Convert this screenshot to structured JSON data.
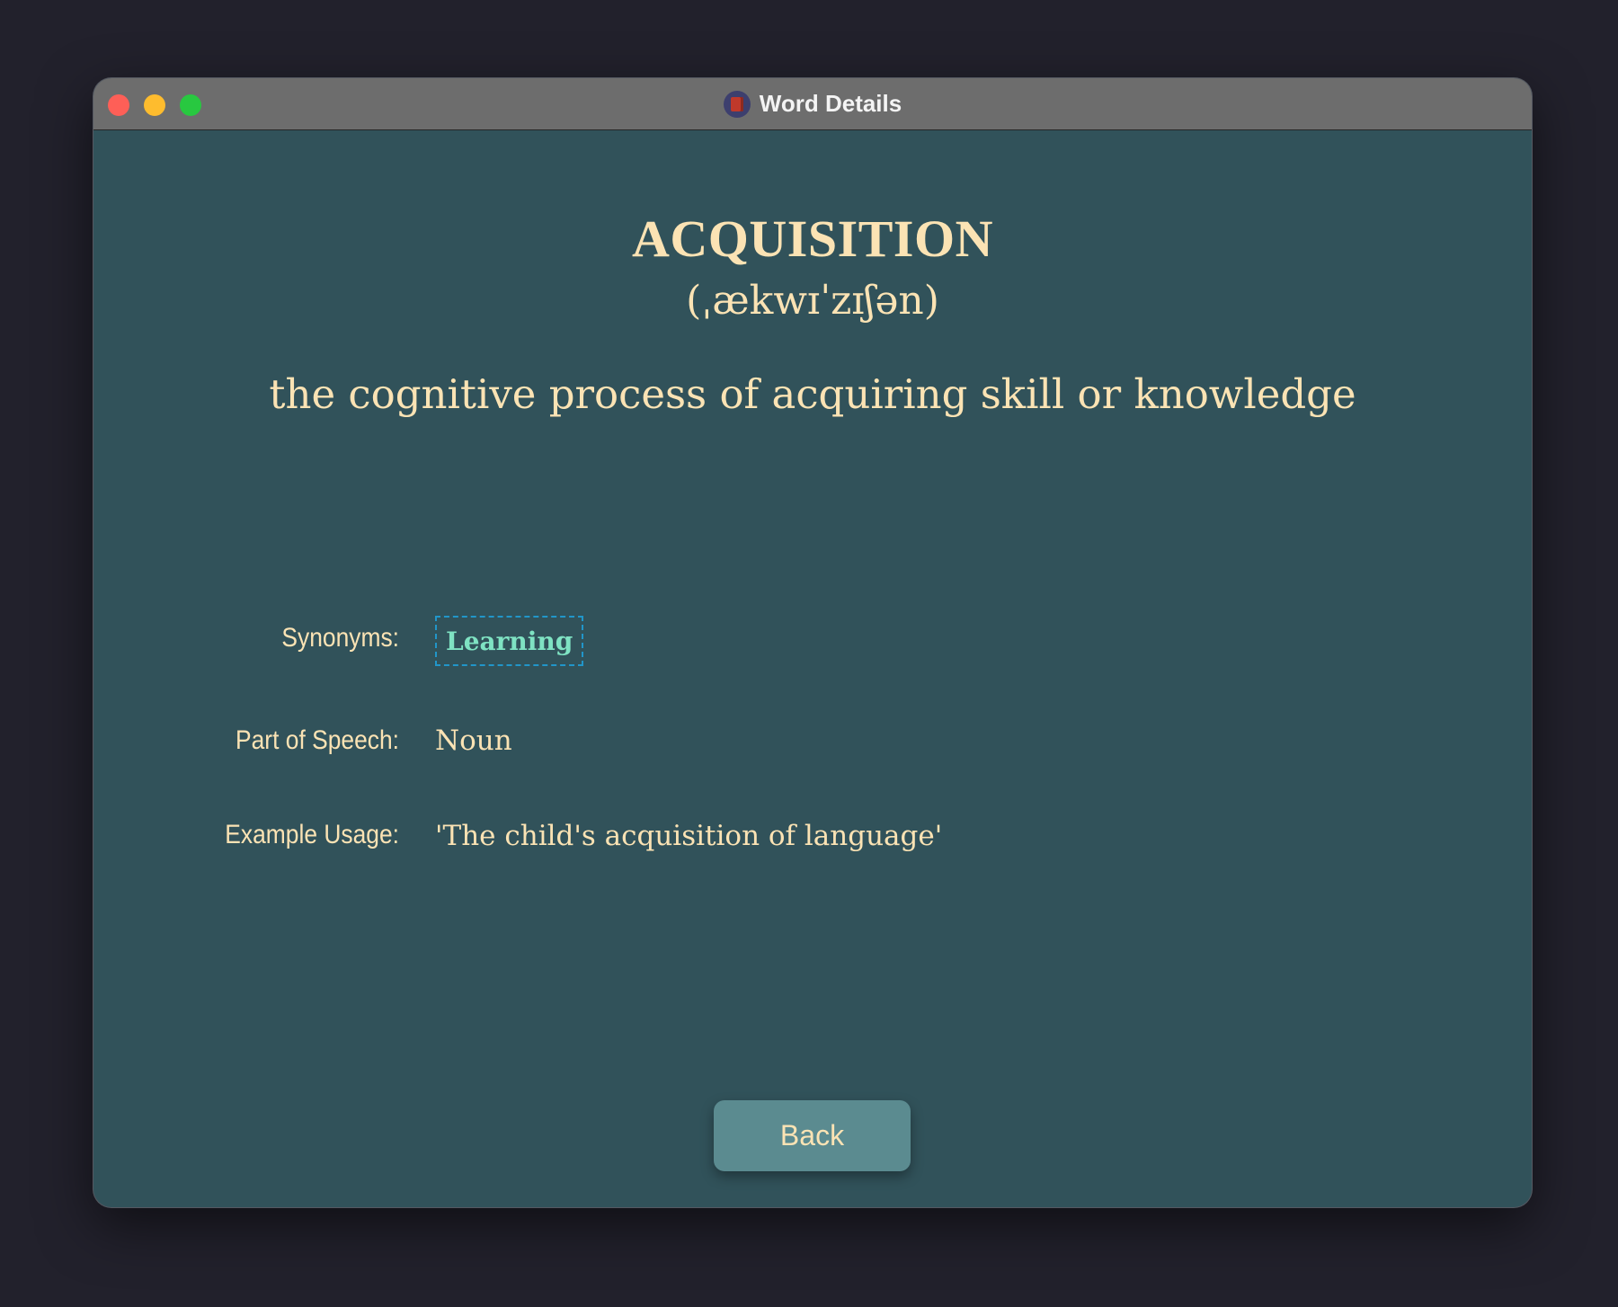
{
  "window": {
    "title": "Word Details",
    "icon": "book-icon"
  },
  "word": {
    "headword": "ACQUISITION",
    "phonetic": "(ˌækwɪˈzɪʃən)",
    "definition": "the cognitive process of acquiring skill or knowledge"
  },
  "details": {
    "synonyms_label": "Synonyms:",
    "synonyms": [
      "Learning"
    ],
    "part_of_speech_label": "Part of Speech:",
    "part_of_speech": "Noun",
    "example_label": "Example Usage:",
    "example": "'The child's acquisition of language'"
  },
  "actions": {
    "back_label": "Back"
  },
  "colors": {
    "background": "#31525a",
    "text": "#fbe3b4",
    "synonym": "#7fe3c3",
    "synonym_border": "#2196c9",
    "button": "#5b8b90"
  }
}
